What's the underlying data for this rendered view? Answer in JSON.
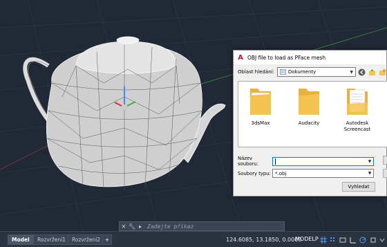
{
  "dialog": {
    "title": "OBJ file to load as PFace mesh",
    "title_icon": "autocad-a-icon",
    "look_in_label": "Oblast hledání:",
    "look_in_value": "Dokumenty",
    "files": [
      {
        "name": "3dsMax",
        "icon": "folder-icon"
      },
      {
        "name": "Audacity",
        "icon": "folder-icon"
      },
      {
        "name": "Autodesk Screencast",
        "icon": "folder-with-documents-icon"
      }
    ],
    "filename_label": "Název souboru:",
    "filename_value": "",
    "filetype_label": "Soubory typu:",
    "filetype_value": "*.obj",
    "search_button": "Vyhledat"
  },
  "command_line": {
    "prompt": "Zadejte příkaz"
  },
  "status_bar": {
    "tabs": [
      "Model",
      "Rozvržení1",
      "Rozvržení2"
    ],
    "add_tab": "+",
    "coordinates": "124.6085, 13.1850, 0.0000",
    "mode": "MODELP"
  },
  "colors": {
    "viewport_bg": "#212836",
    "autocad_red": "#c8102e",
    "folder_yellow": "#f3c451",
    "accent_blue": "#0078d7"
  }
}
